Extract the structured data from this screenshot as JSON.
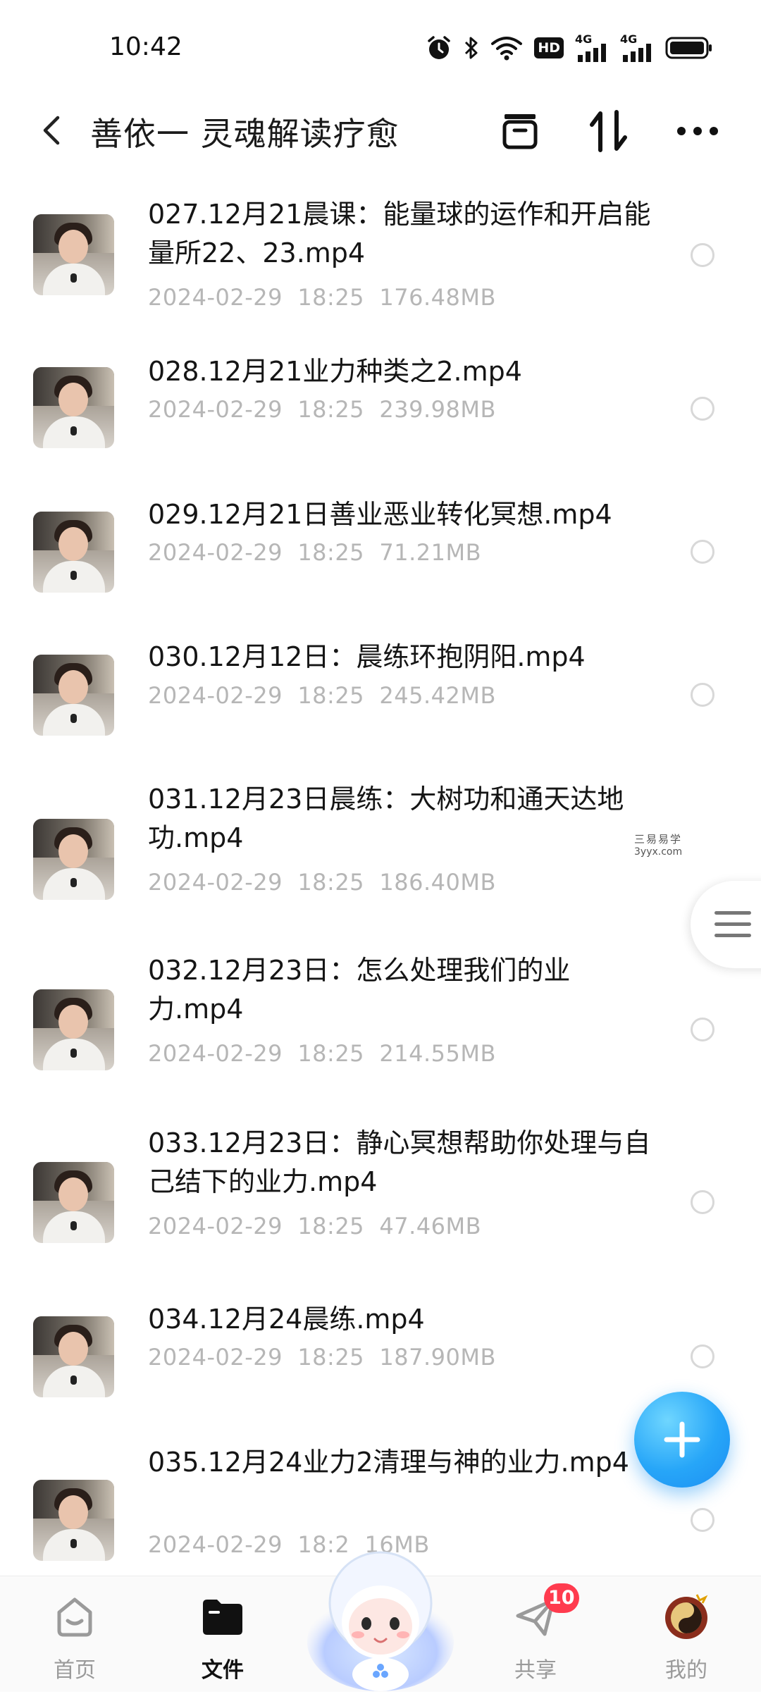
{
  "status_bar": {
    "time": "10:42",
    "icons": [
      "alarm-icon",
      "bluetooth-icon",
      "wifi-icon",
      "hd-icon",
      "signal-4g-icon",
      "signal-4g-icon",
      "battery-icon"
    ],
    "hd_text": "HD",
    "network_1": "4G",
    "network_2": "4G"
  },
  "header": {
    "title": "善依一 灵魂解读疗愈",
    "back_icon": "chevron-left-icon",
    "actions": [
      "archive-icon",
      "sort-icon",
      "more-icon"
    ]
  },
  "files": [
    {
      "name": "027.12月21晨课：能量球的运作和开启能量所22、23.mp4",
      "date": "2024-02-29",
      "time": "18:25",
      "size": "176.48MB"
    },
    {
      "name": "028.12月21业力种类之2.mp4",
      "date": "2024-02-29",
      "time": "18:25",
      "size": "239.98MB"
    },
    {
      "name": "029.12月21日善业恶业转化冥想.mp4",
      "date": "2024-02-29",
      "time": "18:25",
      "size": "71.21MB"
    },
    {
      "name": "030.12月12日：晨练环抱阴阳.mp4",
      "date": "2024-02-29",
      "time": "18:25",
      "size": "245.42MB"
    },
    {
      "name": "031.12月23日晨练：大树功和通天达地功.mp4",
      "date": "2024-02-29",
      "time": "18:25",
      "size": "186.40MB"
    },
    {
      "name": "032.12月23日：怎么处理我们的业力.mp4",
      "date": "2024-02-29",
      "time": "18:25",
      "size": "214.55MB"
    },
    {
      "name": "033.12月23日：静心冥想帮助你处理与自己结下的业力.mp4",
      "date": "2024-02-29",
      "time": "18:25",
      "size": "47.46MB"
    },
    {
      "name": "034.12月24晨练.mp4",
      "date": "2024-02-29",
      "time": "18:25",
      "size": "187.90MB"
    },
    {
      "name": "035.12月24业力2清理与神的业力.mp4",
      "date": "2024-02-29",
      "time": "18:2",
      "size": "16MB"
    }
  ],
  "watermark": {
    "line1": "三易易学",
    "line2": "3yyx.com"
  },
  "fab": {
    "icon": "plus-icon"
  },
  "bottom_nav": {
    "items": [
      {
        "label": "首页",
        "icon": "home-icon",
        "active": false
      },
      {
        "label": "文件",
        "icon": "folder-icon",
        "active": true
      },
      {
        "label": "",
        "icon": "assistant-mascot-icon",
        "active": false
      },
      {
        "label": "共享",
        "icon": "send-icon",
        "active": false,
        "badge": "10"
      },
      {
        "label": "我的",
        "icon": "profile-avatar-icon",
        "active": false
      }
    ]
  },
  "colors": {
    "fab": "#27a6f8",
    "badge": "#ff3b4e",
    "meta_text": "#b6b6b6",
    "title_text": "#1a1a1a"
  }
}
